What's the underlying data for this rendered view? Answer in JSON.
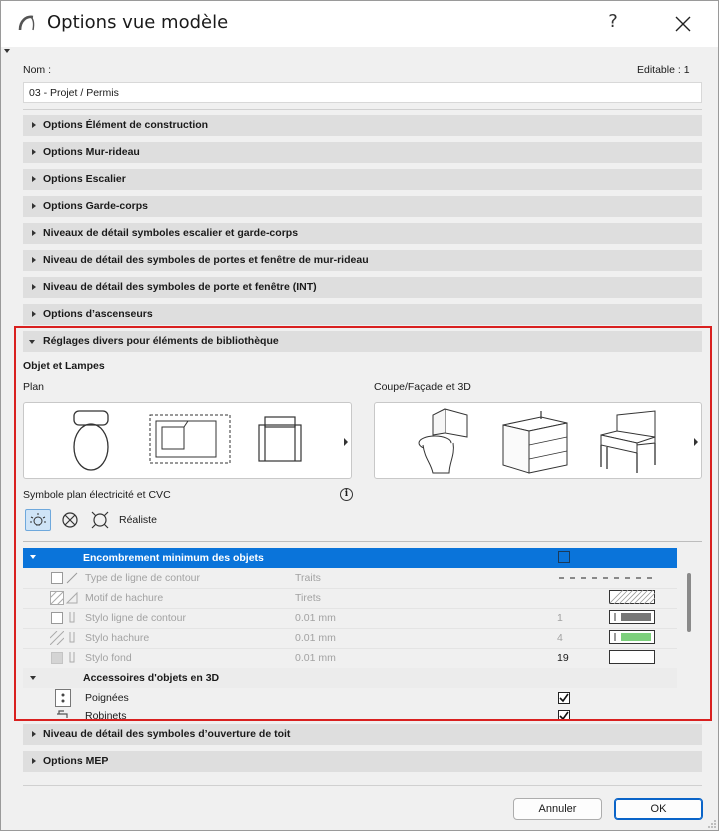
{
  "window": {
    "title": "Options vue modèle",
    "help": "?"
  },
  "name_field": {
    "label": "Nom :",
    "value": "03 - Projet / Permis",
    "editable": "Editable : 1"
  },
  "sections_top": [
    "Options Élément de construction",
    "Options Mur-rideau",
    "Options Escalier",
    "Options Garde-corps",
    "Niveaux de détail symboles escalier et garde-corps",
    "Niveau de détail des symboles de portes et fenêtre de mur-rideau",
    "Niveau de détail des symboles de porte et fenêtre (INT)",
    "Options d’ascenseurs"
  ],
  "library_section": {
    "title": "Réglages divers pour éléments de bibliothèque",
    "group_title": "Objet et Lampes",
    "plan_label": "Plan",
    "section_label": "Coupe/Façade et 3D",
    "symbol_label": "Symbole plan électricité et CVC",
    "realistic_label": "Réaliste"
  },
  "table": {
    "header": {
      "label": "Encombrement minimum des objets",
      "checked": false
    },
    "rows": [
      {
        "label": "Type de ligne de contour",
        "value": "Traits",
        "num": ""
      },
      {
        "label": "Motif de hachure",
        "value": "Tirets",
        "num": ""
      },
      {
        "label": "Stylo ligne de contour",
        "value": "0.01 mm",
        "num": "1"
      },
      {
        "label": "Stylo hachure",
        "value": "0.01 mm",
        "num": "4"
      },
      {
        "label": "Stylo fond",
        "value": "0.01 mm",
        "num": "19"
      }
    ],
    "subgroup": "Accessoires d'objets en 3D",
    "sub_rows": [
      {
        "label": "Poignées",
        "checked": true
      },
      {
        "label": "Robinets",
        "checked": true
      }
    ]
  },
  "sections_bottom": [
    "Niveau de détail des symboles d’ouverture de toit",
    "Options MEP"
  ],
  "buttons": {
    "cancel": "Annuler",
    "ok": "OK"
  },
  "colors": {
    "accent": "#0a74da",
    "highlight": "#d9201f",
    "pen_hatch": "#7ccf7c"
  }
}
